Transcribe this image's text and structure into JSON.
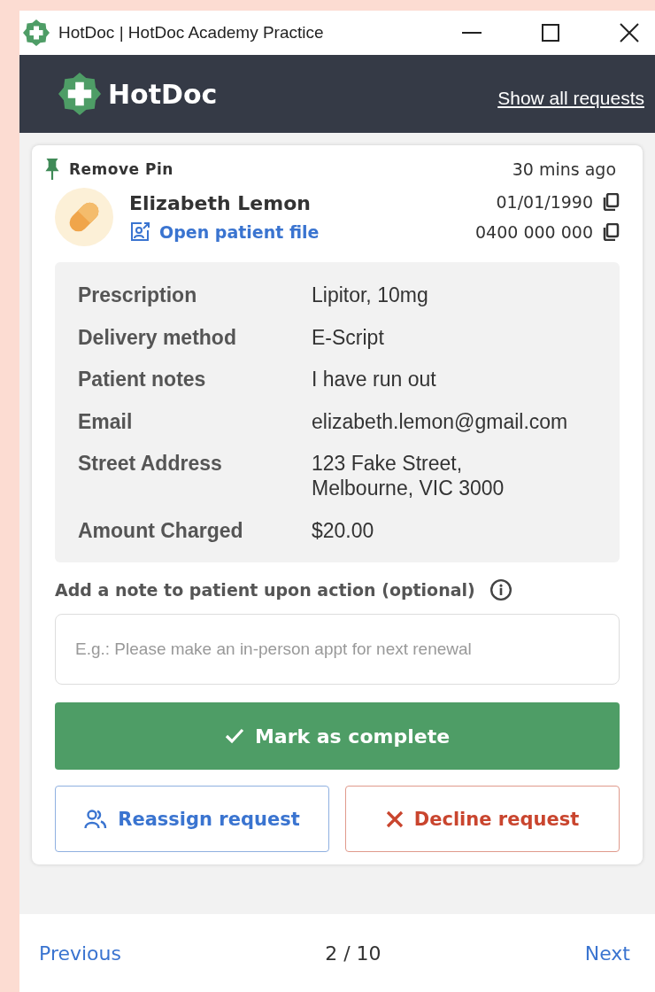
{
  "window": {
    "title": "HotDoc | HotDoc Academy Practice"
  },
  "header": {
    "logo": "HotDoc",
    "link": "Show all requests"
  },
  "request": {
    "pin_label": "Remove Pin",
    "time": "30 mins ago",
    "patient_name": "Elizabeth Lemon",
    "open_file": "Open patient file",
    "dob": "01/01/1990",
    "phone": "0400 000 000",
    "details": [
      {
        "label": "Prescription",
        "value": "Lipitor, 10mg"
      },
      {
        "label": "Delivery method",
        "value": "E-Script"
      },
      {
        "label": "Patient notes",
        "value": "I have run out"
      },
      {
        "label": "Email",
        "value": "elizabeth.lemon@gmail.com"
      },
      {
        "label": "Street Address",
        "value": "123 Fake Street,\nMelbourne, VIC 3000"
      },
      {
        "label": "Amount Charged",
        "value": "$20.00"
      }
    ],
    "note_label": "Add a note to patient upon action (optional)",
    "note_placeholder": "E.g.: Please make an in-person appt for next renewal",
    "complete": "Mark as complete",
    "reassign": "Reassign request",
    "decline": "Decline request"
  },
  "pager": {
    "previous": "Previous",
    "position": "2 / 10",
    "next": "Next"
  }
}
